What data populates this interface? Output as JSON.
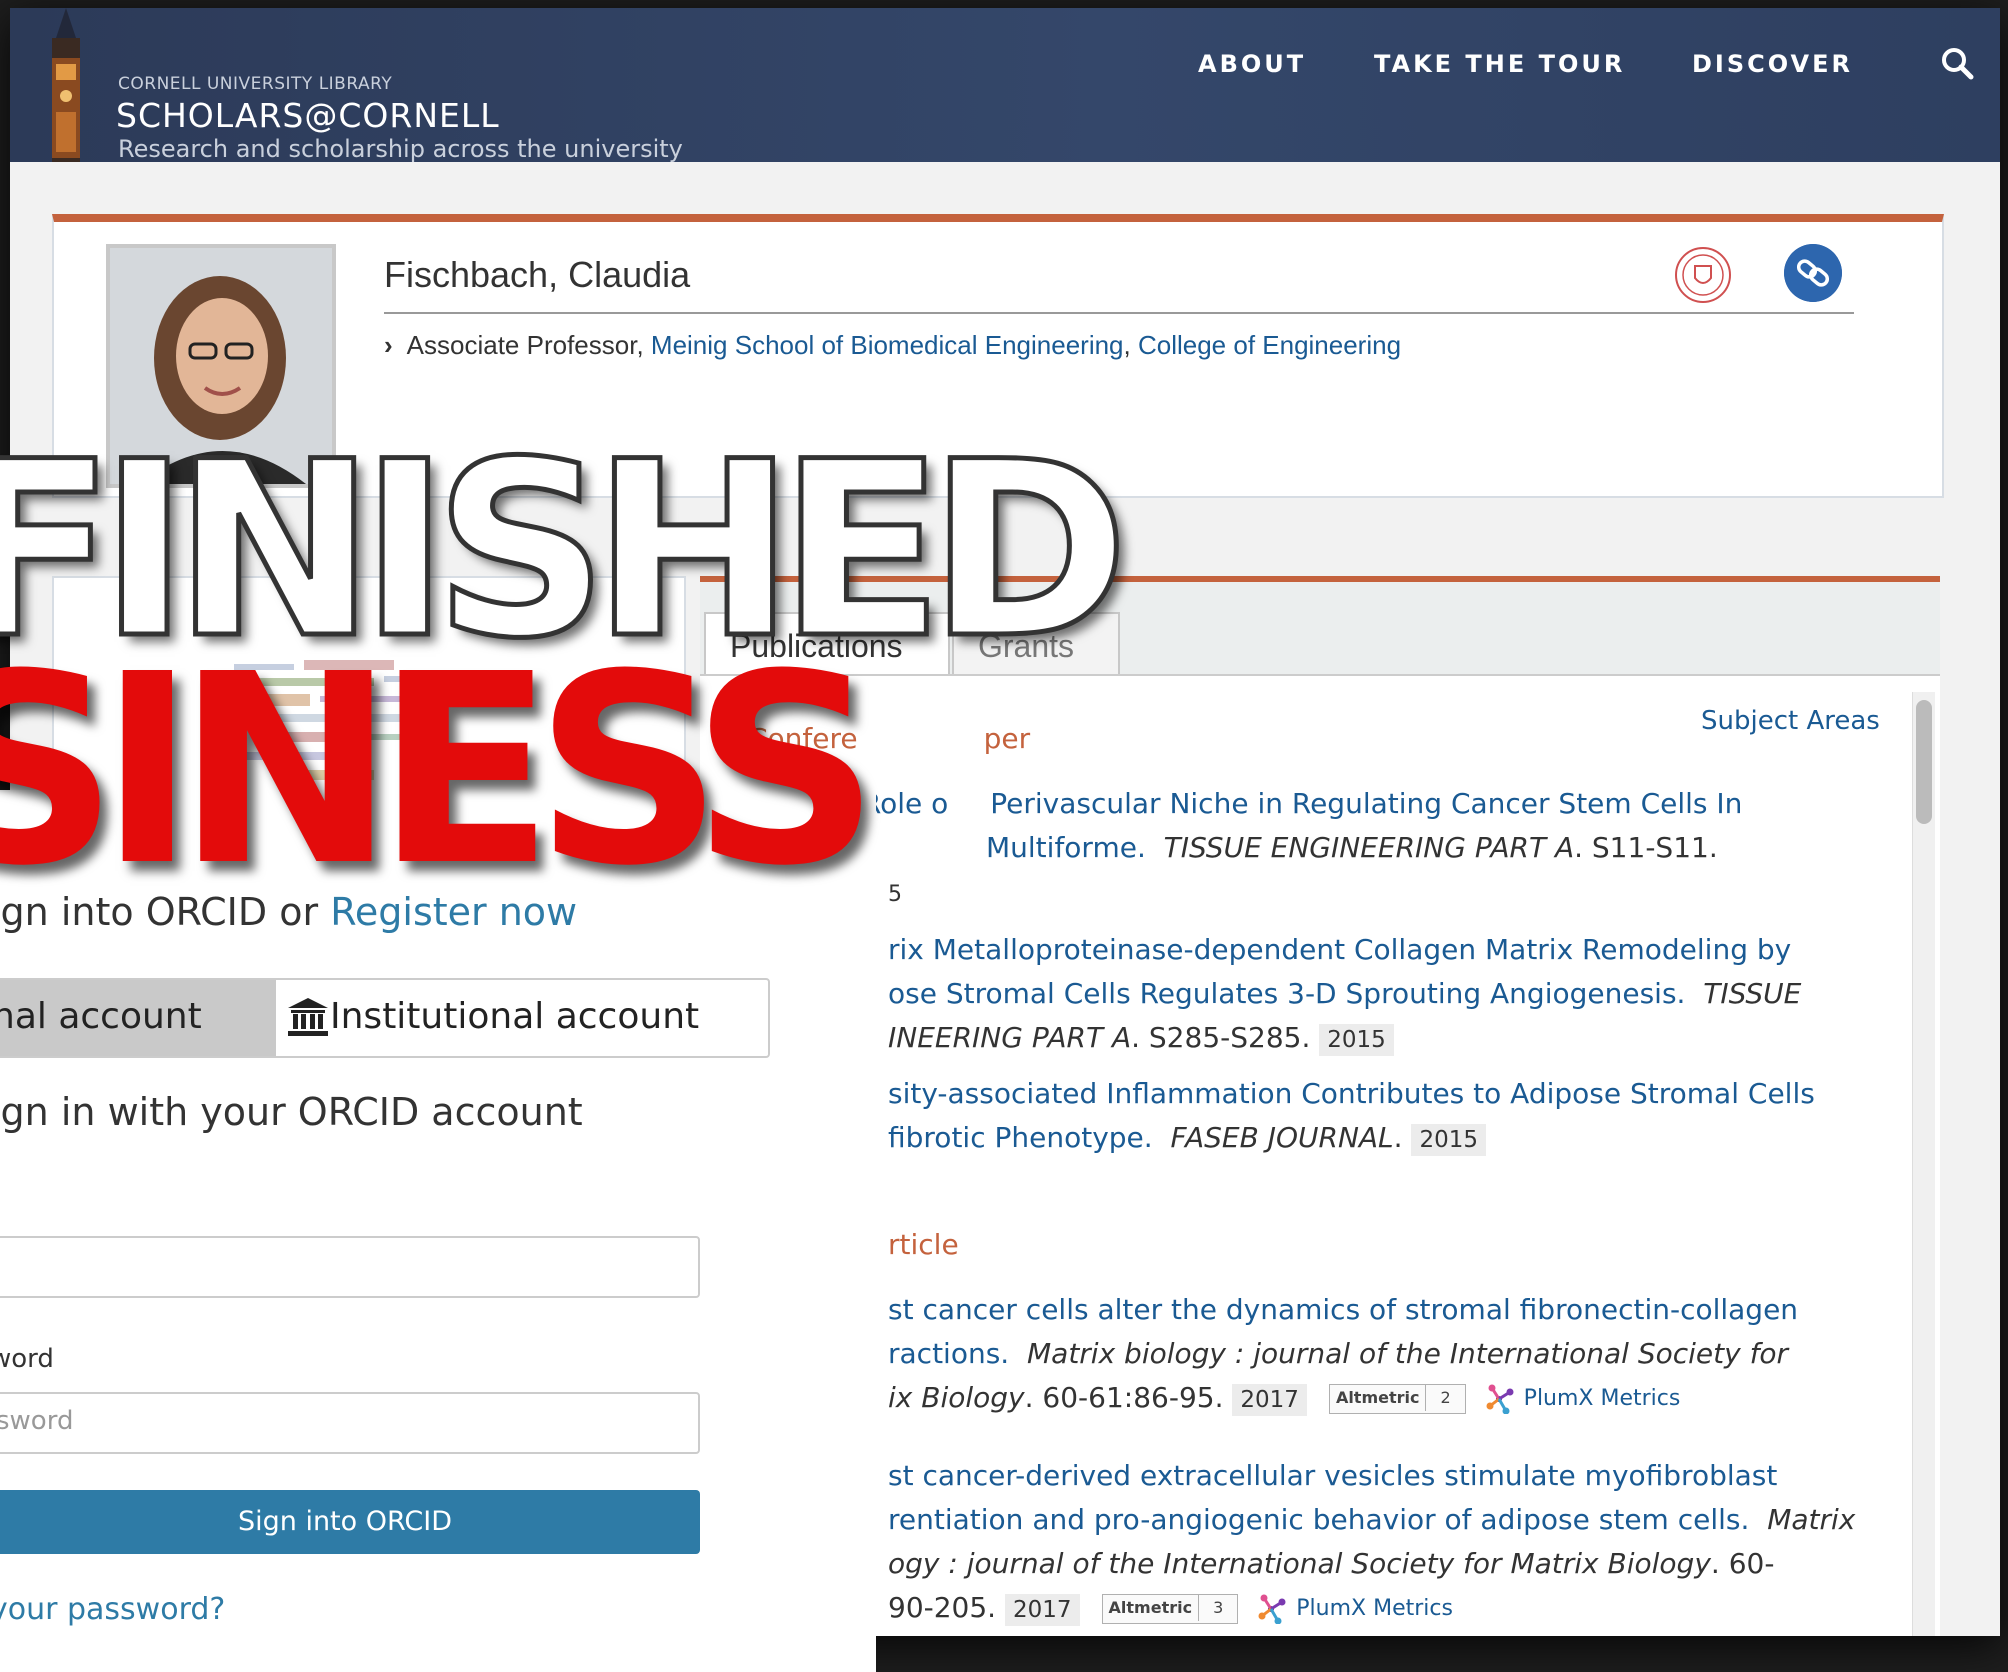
{
  "header": {
    "library_label": "CORNELL UNIVERSITY LIBRARY",
    "site_name": "SCHOLARS@CORNELL",
    "tagline": "Research and scholarship across the university",
    "nav": [
      "ABOUT",
      "TAKE THE TOUR",
      "DISCOVER"
    ],
    "search_icon": "search-icon"
  },
  "profile": {
    "name": "Fischbach, Claudia",
    "position": "Associate Professor,",
    "department": "Meinig School of Biomedical Engineering",
    "college": "College of Engineering"
  },
  "tabs": [
    "Publications",
    "Grants"
  ],
  "subject_areas_link": "Subject Areas",
  "sections": {
    "conference": "Confere",
    "conference_tail": "per",
    "article": "rticle"
  },
  "publications": [
    {
      "line1": "Perivascular Niche in Regulating Cancer Stem Cells In",
      "line1_prefix": "he Role o",
      "line2_title": "Multiforme.",
      "journal": "TISSUE ENGINEERING PART A",
      "pages": ". S11-S11.",
      "line3": "5"
    },
    {
      "line1": "rix Metalloproteinase-dependent Collagen Matrix Remodeling by",
      "line2_title": "ose Stromal Cells Regulates 3-D Sprouting Angiogenesis.",
      "journal": "TISSUE",
      "line3_journal": "INEERING PART A",
      "pages": ". S285-S285.",
      "year": "2015"
    },
    {
      "line1": "sity-associated Inflammation Contributes to Adipose Stromal Cells",
      "line2_title": "fibrotic Phenotype.",
      "journal": "FASEB JOURNAL",
      "pages": ".",
      "year": "2015"
    },
    {
      "line1": "st cancer cells alter the dynamics of stromal fibronectin-collagen",
      "line2_title": "ractions.",
      "journal": "Matrix biology : journal of the International Society for",
      "line3_journal": "ix Biology",
      "pages": ". 60-61:86-95.",
      "year": "2017",
      "altmetric": "Altmetric",
      "alt_count": "2",
      "plumx": "PlumX Metrics"
    },
    {
      "line1": "st cancer-derived extracellular vesicles stimulate myofibroblast",
      "line2_title": "rentiation and pro-angiogenic behavior of adipose stem cells.",
      "journal": "Matrix",
      "line3_journal": "ogy : journal of the International Society for Matrix Biology",
      "line3_tail": ". 60-",
      "line4": "90-205.",
      "year": "2017",
      "altmetric": "Altmetric",
      "alt_count": "3",
      "plumx": "PlumX Metrics"
    }
  ],
  "orcid": {
    "heading_prefix": "ign into ORCID or",
    "register": "Register now",
    "personal_account": "nal account",
    "institutional_account": "Institutional account",
    "signin_sub": "ign in with your ORCID account",
    "password_label": "word",
    "password_placeholder": "sword",
    "signin_button": "Sign into ORCID",
    "forgot": "your password?"
  },
  "meme": {
    "line1": "FINISHED",
    "line2": "SINESS"
  },
  "colors": {
    "header_bg": "#2c3a58",
    "accent_orange": "#c4623d",
    "link_blue": "#1a5a93",
    "orcid_blue": "#2e7ba6",
    "meme_red": "#e30b0b"
  }
}
